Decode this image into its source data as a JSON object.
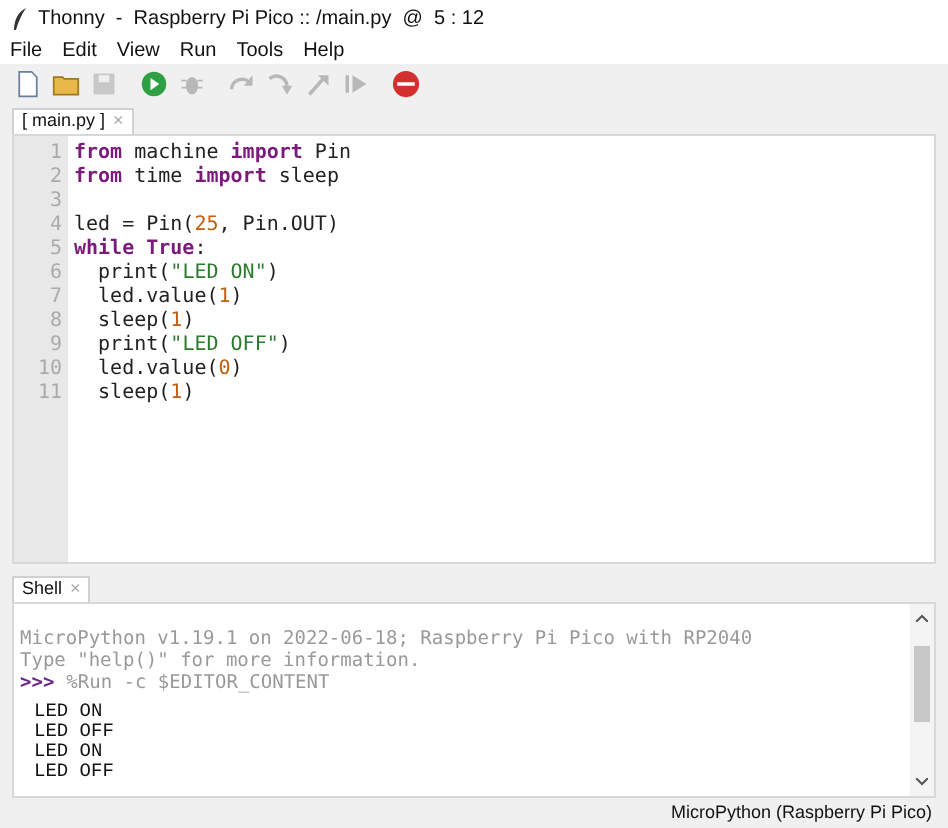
{
  "window": {
    "title": "Thonny  -  Raspberry Pi Pico :: /main.py  @  5 : 12"
  },
  "menu": [
    "File",
    "Edit",
    "View",
    "Run",
    "Tools",
    "Help"
  ],
  "toolbar": [
    {
      "kind": "new",
      "disabled": false
    },
    {
      "kind": "open",
      "disabled": false
    },
    {
      "kind": "save",
      "disabled": true
    },
    {
      "kind": "run",
      "disabled": false
    },
    {
      "kind": "debug",
      "disabled": true
    },
    {
      "kind": "step-over",
      "disabled": true
    },
    {
      "kind": "step-into",
      "disabled": true
    },
    {
      "kind": "step-out",
      "disabled": true
    },
    {
      "kind": "resume",
      "disabled": true
    },
    {
      "kind": "stop",
      "disabled": false
    }
  ],
  "editor": {
    "tabs": [
      {
        "label": "[ main.py ]",
        "close": "×",
        "selected": true
      }
    ],
    "lines": [
      {
        "number": "1",
        "tokens": [
          {
            "kind": "keyword",
            "text": "from"
          },
          {
            "kind": "plain",
            "text": " machine "
          },
          {
            "kind": "keyword",
            "text": "import"
          },
          {
            "kind": "plain",
            "text": " Pin"
          }
        ]
      },
      {
        "number": "2",
        "tokens": [
          {
            "kind": "keyword",
            "text": "from"
          },
          {
            "kind": "plain",
            "text": " time "
          },
          {
            "kind": "keyword",
            "text": "import"
          },
          {
            "kind": "plain",
            "text": " sleep"
          }
        ]
      },
      {
        "number": "3"
      },
      {
        "number": "4",
        "tokens": [
          {
            "kind": "plain",
            "text": "led = Pin("
          },
          {
            "kind": "number",
            "text": "25"
          },
          {
            "kind": "plain",
            "text": ", Pin.OUT)"
          }
        ]
      },
      {
        "number": "5",
        "tokens": [
          {
            "kind": "keyword",
            "text": "while "
          },
          {
            "kind": "keyword",
            "text": "True"
          },
          {
            "kind": "plain",
            "text": ":"
          }
        ]
      },
      {
        "number": "6",
        "tokens": [
          {
            "kind": "plain",
            "text": "  print("
          },
          {
            "kind": "string",
            "text": "\"LED ON\""
          },
          {
            "kind": "plain",
            "text": ")"
          }
        ]
      },
      {
        "number": "7",
        "tokens": [
          {
            "kind": "plain",
            "text": "  led.value("
          },
          {
            "kind": "number",
            "text": "1"
          },
          {
            "kind": "plain",
            "text": ")"
          }
        ]
      },
      {
        "number": "8",
        "tokens": [
          {
            "kind": "plain",
            "text": "  sleep("
          },
          {
            "kind": "number",
            "text": "1"
          },
          {
            "kind": "plain",
            "text": ")"
          }
        ]
      },
      {
        "number": "9",
        "tokens": [
          {
            "kind": "plain",
            "text": "  print("
          },
          {
            "kind": "string",
            "text": "\"LED OFF\""
          },
          {
            "kind": "plain",
            "text": ")"
          }
        ]
      },
      {
        "number": "10",
        "tokens": [
          {
            "kind": "plain",
            "text": "  led.value("
          },
          {
            "kind": "number",
            "text": "0"
          },
          {
            "kind": "plain",
            "text": ")"
          }
        ]
      },
      {
        "number": "11",
        "tokens": [
          {
            "kind": "plain",
            "text": "  sleep("
          },
          {
            "kind": "number",
            "text": "1"
          },
          {
            "kind": "plain",
            "text": ")"
          }
        ]
      }
    ]
  },
  "shell": {
    "tabs": [
      {
        "label": "Shell",
        "close": "×",
        "selected": true
      }
    ],
    "lines": [
      {
        "kind": "banner",
        "text": "MicroPython v1.19.1 on 2022-06-18; Raspberry Pi Pico with RP2040"
      },
      {
        "kind": "banner",
        "text": "Type \"help()\" for more information."
      },
      {
        "kind": "command",
        "prompt": ">>>",
        "text": "%Run -c $EDITOR_CONTENT"
      },
      {
        "kind": "output",
        "text": "LED ON"
      },
      {
        "kind": "output",
        "text": "LED OFF"
      },
      {
        "kind": "output",
        "text": "LED ON"
      },
      {
        "kind": "output",
        "text": "LED OFF"
      }
    ]
  },
  "status_bar": {
    "interpreter": "MicroPython (Raspberry Pi Pico)"
  }
}
